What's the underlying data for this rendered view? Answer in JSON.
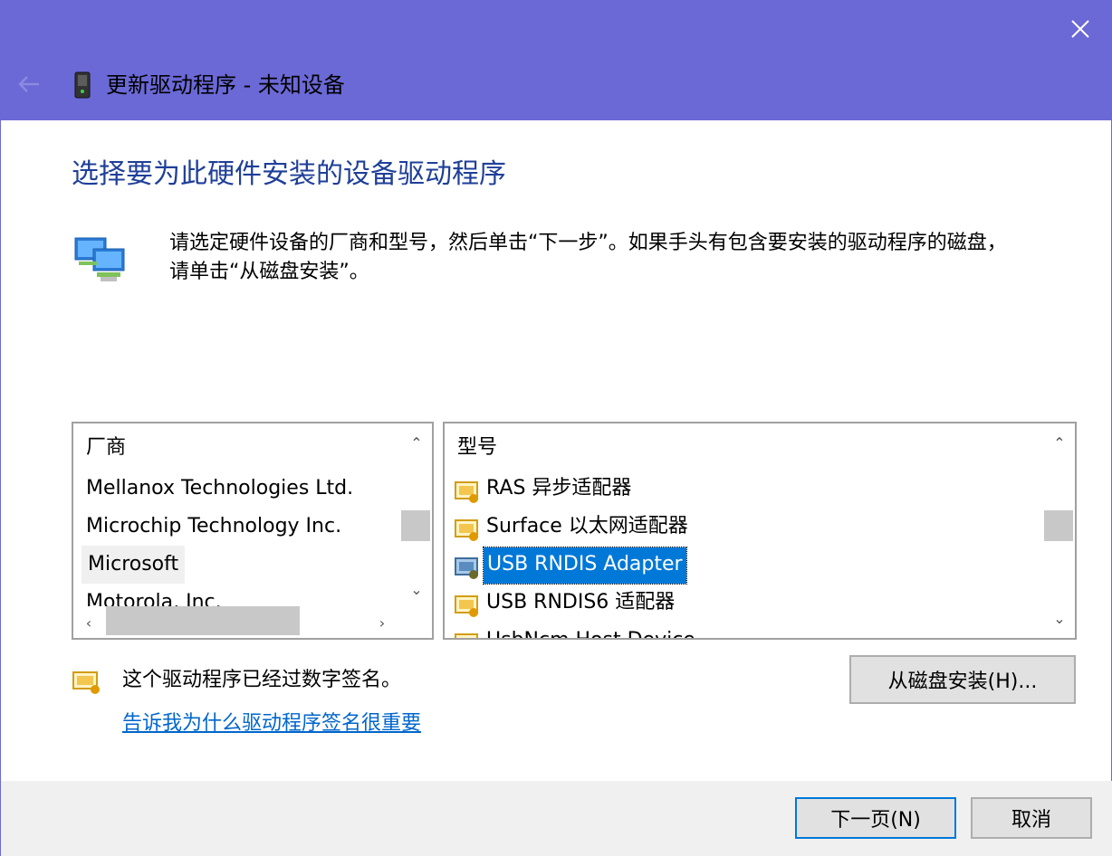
{
  "window": {
    "title": "更新驱动程序 - 未知设备",
    "accent_color": "#6b69d6"
  },
  "main": {
    "heading": "选择要为此硬件安装的设备驱动程序",
    "instructions_line1": "请选定硬件设备的厂商和型号，然后单击“下一步”。如果手头有包含要安装的驱动程序的磁盘，",
    "instructions_line2": "请单击“从磁盘安装”。"
  },
  "manufacturers": {
    "header": "厂商",
    "items": [
      "Mellanox Technologies Ltd.",
      "Microchip Technology Inc.",
      "Microsoft",
      "Motorola, Inc."
    ],
    "selected": "Microsoft"
  },
  "models": {
    "header": "型号",
    "items": [
      "RAS 异步适配器",
      "Surface 以太网适配器",
      "USB RNDIS Adapter",
      "USB RNDIS6 适配器",
      "UsbNcm Host Device"
    ],
    "selected": "USB RNDIS Adapter"
  },
  "signature": {
    "status": "这个驱动程序已经过数字签名。",
    "link": "告诉我为什么驱动程序签名很重要"
  },
  "buttons": {
    "have_disk": "从磁盘安装(H)...",
    "next": "下一页(N)",
    "cancel": "取消"
  },
  "icons": {
    "back": "back-arrow-icon",
    "device": "unknown-device-icon",
    "hardware": "network-adapter-icon",
    "driver": "driver-certificate-icon",
    "close": "close-icon"
  }
}
